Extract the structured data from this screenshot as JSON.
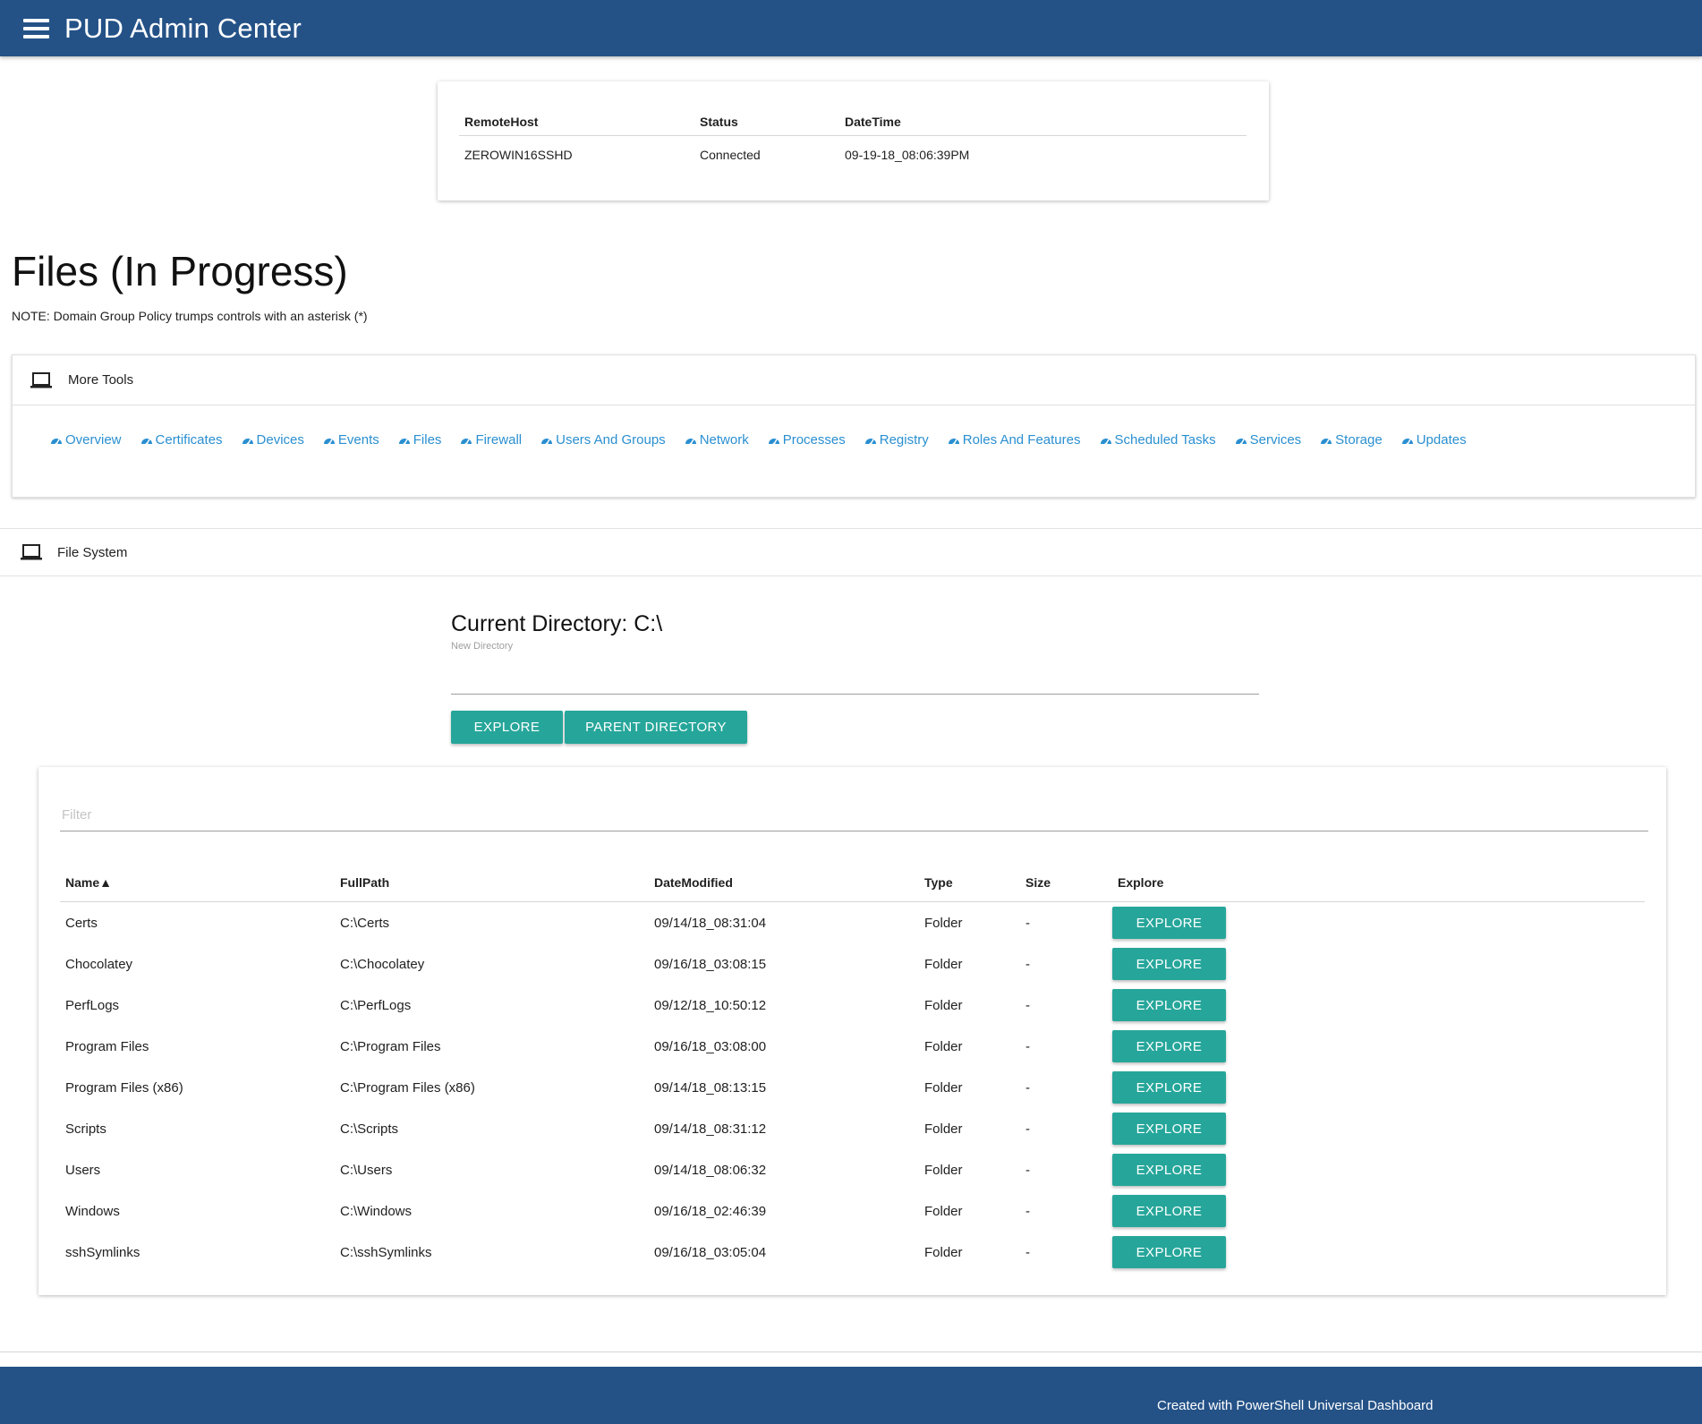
{
  "header": {
    "title": "PUD Admin Center",
    "brand_color": "#245287"
  },
  "connection": {
    "columns": [
      "RemoteHost",
      "Status",
      "DateTime"
    ],
    "rows": [
      [
        "ZEROWIN16SSHD",
        "Connected",
        "09-19-18_08:06:39PM"
      ]
    ]
  },
  "page": {
    "title": "Files (In Progress)",
    "note": "NOTE: Domain Group Policy trumps controls with an asterisk (*)"
  },
  "more_tools": {
    "title": "More Tools",
    "link_color": "#2a8fd0",
    "links": [
      "Overview",
      "Certificates",
      "Devices",
      "Events",
      "Files",
      "Firewall",
      "Users And Groups",
      "Network",
      "Processes",
      "Registry",
      "Roles And Features",
      "Scheduled Tasks",
      "Services",
      "Storage",
      "Updates"
    ]
  },
  "file_system": {
    "title": "File System",
    "current_directory": "Current Directory: C:\\",
    "new_directory_label": "New Directory",
    "new_directory_value": "",
    "explore_button": "EXPLORE",
    "parent_button": "PARENT DIRECTORY",
    "button_color": "#26a69a"
  },
  "grid": {
    "filter_placeholder": "Filter",
    "columns": [
      "Name▲",
      "FullPath",
      "DateModified",
      "Type",
      "Size",
      "Explore"
    ],
    "row_button": "EXPLORE",
    "rows": [
      [
        "Certs",
        "C:\\Certs",
        "09/14/18_08:31:04",
        "Folder",
        "-"
      ],
      [
        "Chocolatey",
        "C:\\Chocolatey",
        "09/16/18_03:08:15",
        "Folder",
        "-"
      ],
      [
        "PerfLogs",
        "C:\\PerfLogs",
        "09/12/18_10:50:12",
        "Folder",
        "-"
      ],
      [
        "Program Files",
        "C:\\Program Files",
        "09/16/18_03:08:00",
        "Folder",
        "-"
      ],
      [
        "Program Files (x86)",
        "C:\\Program Files (x86)",
        "09/14/18_08:13:15",
        "Folder",
        "-"
      ],
      [
        "Scripts",
        "C:\\Scripts",
        "09/14/18_08:31:12",
        "Folder",
        "-"
      ],
      [
        "Users",
        "C:\\Users",
        "09/14/18_08:06:32",
        "Folder",
        "-"
      ],
      [
        "Windows",
        "C:\\Windows",
        "09/16/18_02:46:39",
        "Folder",
        "-"
      ],
      [
        "sshSymlinks",
        "C:\\sshSymlinks",
        "09/16/18_03:05:04",
        "Folder",
        "-"
      ]
    ]
  },
  "footer": {
    "text": "Created with PowerShell Universal Dashboard"
  },
  "icons": {
    "menu": "hamburger-menu-icon",
    "card": "laptop-icon",
    "tool_link": "dashboard-gauge-icon"
  }
}
